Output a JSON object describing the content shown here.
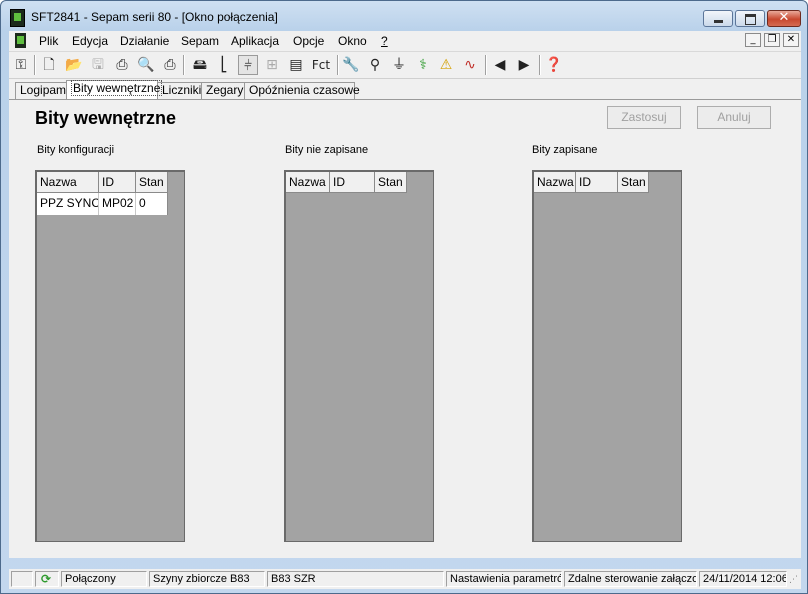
{
  "window": {
    "title": "SFT2841 - Sepam serii 80 - [Okno połączenia]"
  },
  "menu": {
    "items": [
      "Plik",
      "Edycja",
      "Działanie",
      "Sepam",
      "Aplikacja",
      "Opcje",
      "Okno",
      "?"
    ]
  },
  "toolbar": {
    "fct_label": "Fct"
  },
  "tabs": [
    "Logipam",
    "Bity wewnętrzne",
    "Liczniki",
    "Zegary",
    "Opóźnienia czasowe"
  ],
  "page": {
    "title": "Bity wewnętrzne",
    "apply_label": "Zastosuj",
    "cancel_label": "Anuluj"
  },
  "panels": [
    {
      "label": "Bity konfiguracji",
      "columns": [
        "Nazwa",
        "ID",
        "Stan"
      ],
      "rows": [
        [
          "PPZ SYNC",
          "MP02",
          "0"
        ]
      ]
    },
    {
      "label": "Bity nie zapisane",
      "columns": [
        "Nazwa",
        "ID",
        "Stan"
      ],
      "rows": []
    },
    {
      "label": "Bity zapisane",
      "columns": [
        "Nazwa",
        "ID",
        "Stan"
      ],
      "rows": []
    }
  ],
  "status": {
    "connection": "Połączony",
    "busbar": "Szyny zbiorcze B83",
    "device": "B83 SZR",
    "settings": "Nastawienia parametrów",
    "remote": "Zdalne sterowanie załączone",
    "datetime": "24/11/2014 12:06"
  }
}
